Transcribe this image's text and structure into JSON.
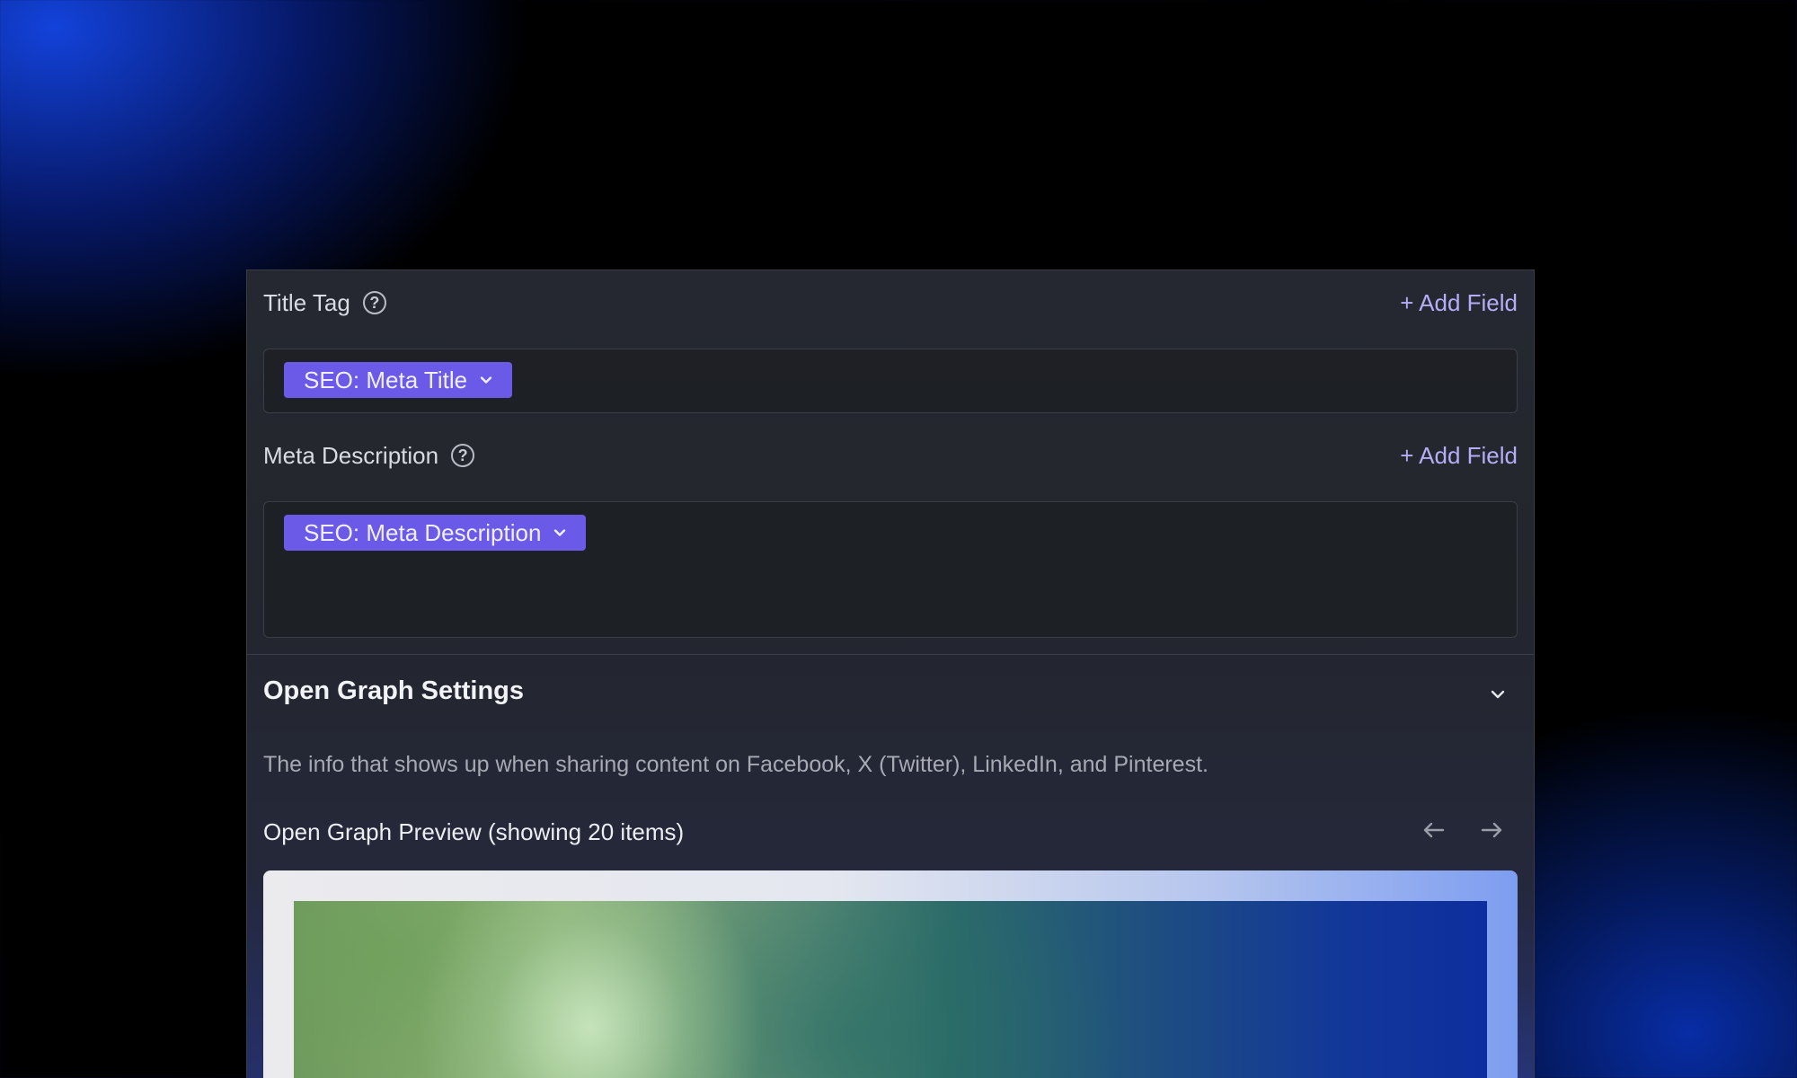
{
  "title_tag": {
    "label": "Title Tag",
    "help": "?",
    "add_field": "+ Add Field",
    "chip_label": "SEO: Meta Title"
  },
  "meta_description": {
    "label": "Meta Description",
    "help": "?",
    "add_field": "+ Add Field",
    "chip_label": "SEO: Meta Description"
  },
  "open_graph": {
    "title": "Open Graph Settings",
    "description": "The info that shows up when sharing content on Facebook, X (Twitter), LinkedIn, and Pinterest.",
    "preview_label": "Open Graph Preview (showing 20 items)"
  },
  "icons": {
    "help": "question-circle-icon",
    "chip_chevron": "chevron-down-icon",
    "section_toggle": "chevron-down-icon",
    "prev": "arrow-left-icon",
    "next": "arrow-right-icon"
  },
  "colors": {
    "accent_chip": "#6b5ae8",
    "link": "#b3aef6",
    "panel_bg": "#23262d"
  }
}
